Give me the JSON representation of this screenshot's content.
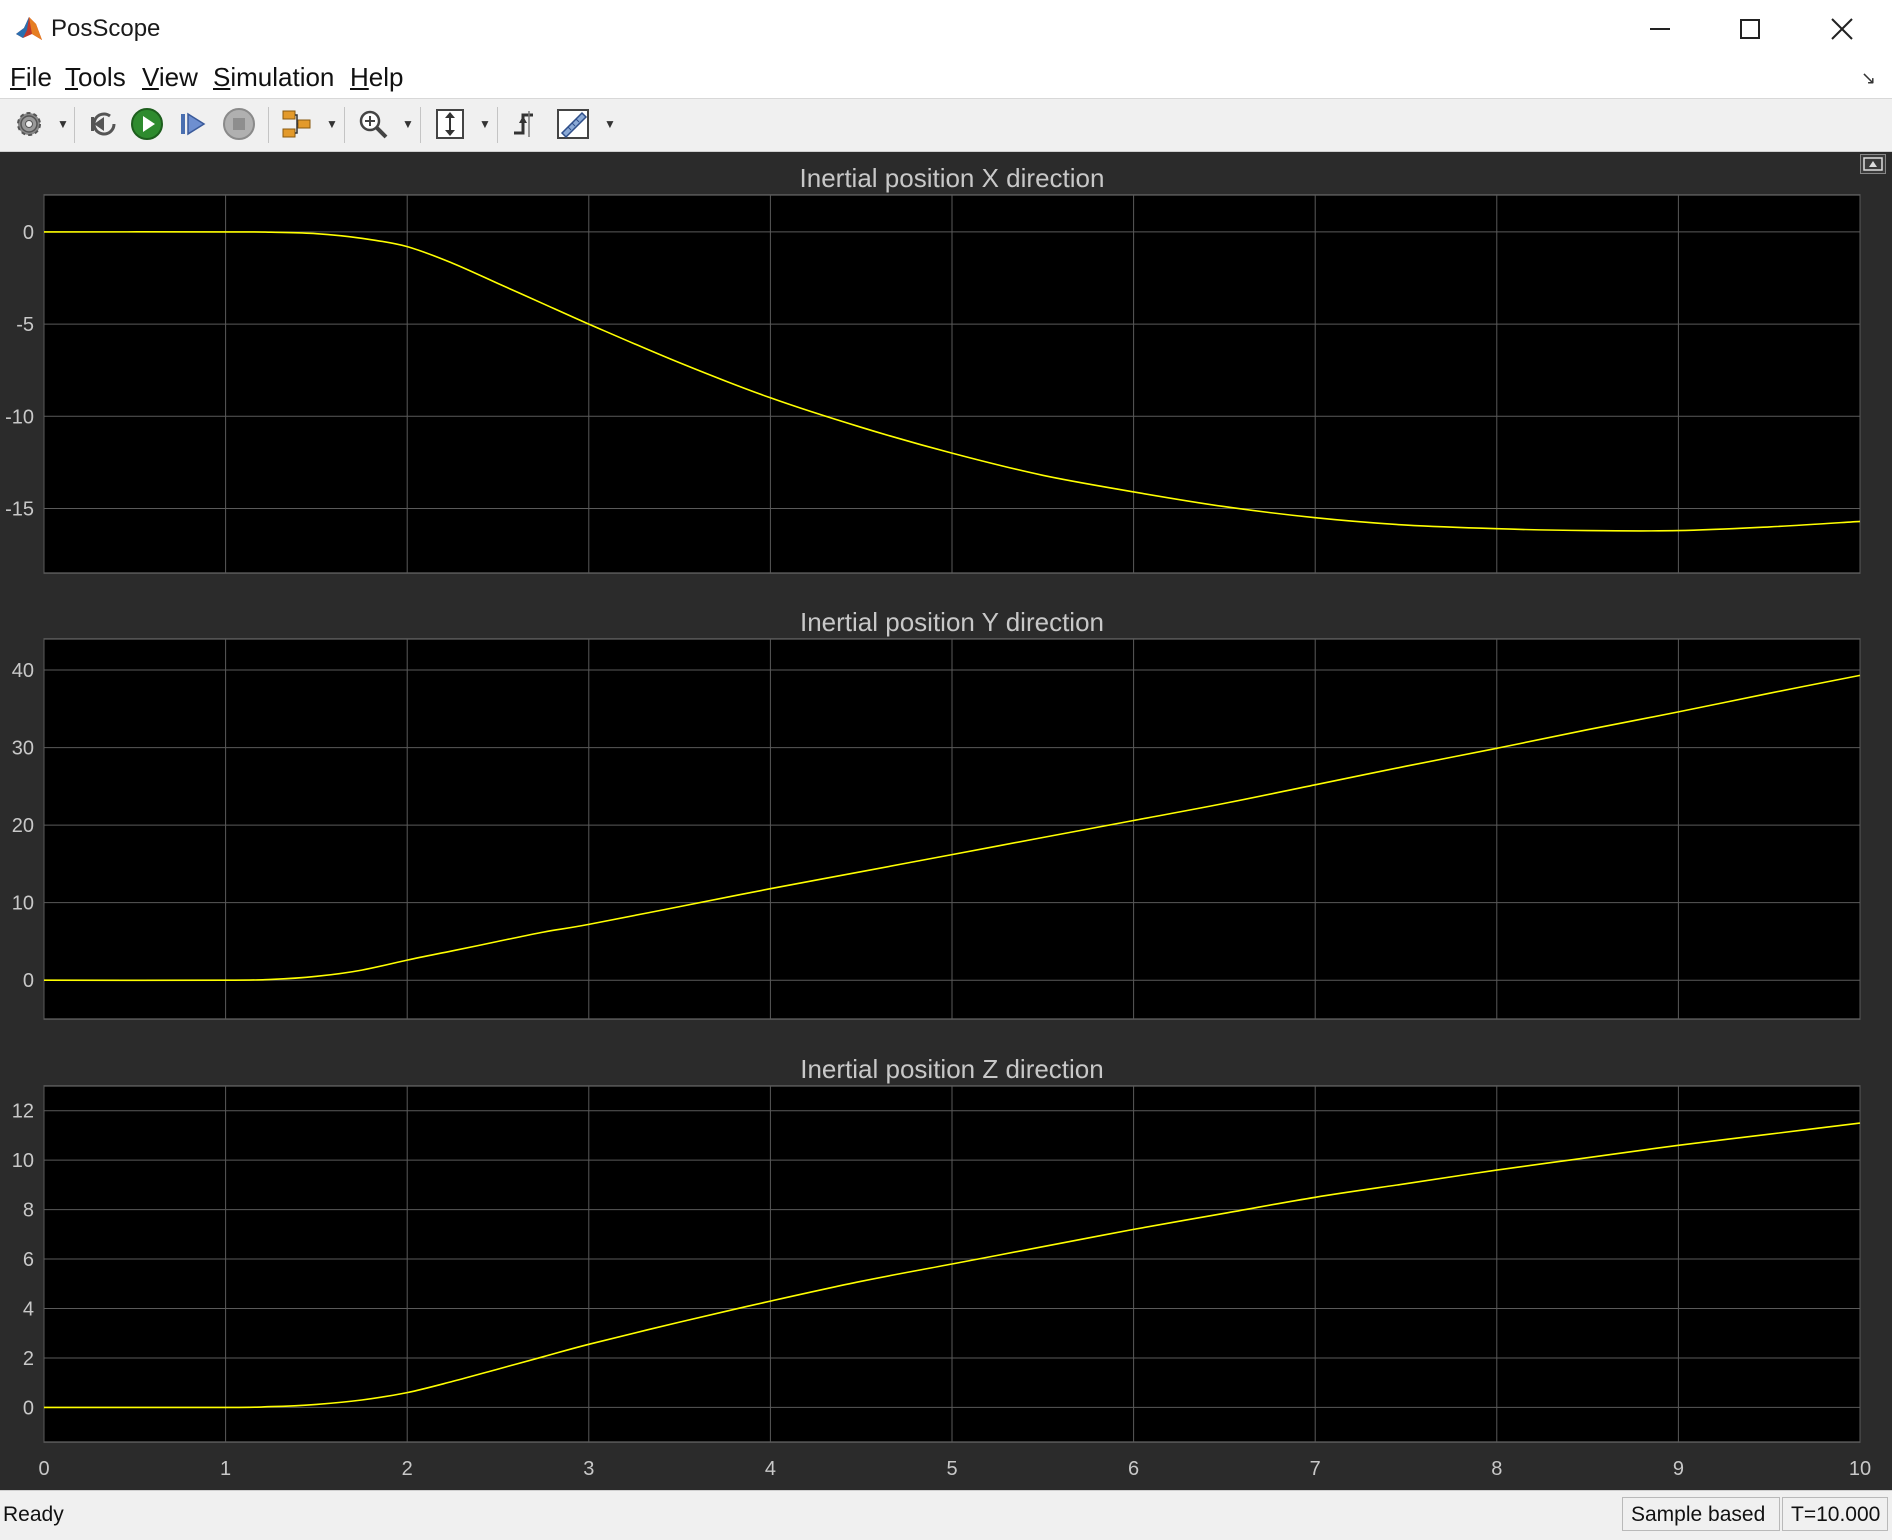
{
  "window": {
    "title": "PosScope"
  },
  "menu": [
    {
      "label": "File"
    },
    {
      "label": "Tools"
    },
    {
      "label": "View"
    },
    {
      "label": "Simulation"
    },
    {
      "label": "Help"
    }
  ],
  "toolbar": {
    "buttons": [
      {
        "name": "settings-button",
        "icon": "gear-icon"
      },
      {
        "name": "step-back-button",
        "icon": "step-back-icon"
      },
      {
        "name": "run-button",
        "icon": "play-icon"
      },
      {
        "name": "step-forward-button",
        "icon": "step-forward-icon"
      },
      {
        "name": "stop-button",
        "icon": "stop-icon"
      },
      {
        "name": "highlight-block-button",
        "icon": "block-diagram-icon"
      },
      {
        "name": "zoom-button",
        "icon": "zoom-in-icon"
      },
      {
        "name": "scale-axes-button",
        "icon": "fit-axes-icon"
      },
      {
        "name": "triggers-button",
        "icon": "trigger-icon"
      },
      {
        "name": "measurements-button",
        "icon": "ruler-icon"
      }
    ]
  },
  "status": {
    "text": "Ready",
    "mode": "Sample based",
    "time": "T=10.000"
  },
  "colors": {
    "trace": "#ffff00",
    "plot_bg": "#000000",
    "scope_bg": "#2b2b2b",
    "grid": "#5a5a5a",
    "text": "#c8c8c8"
  },
  "chart_data": [
    {
      "type": "line",
      "title": "Inertial position X direction",
      "xlim": [
        0,
        10
      ],
      "ylim": [
        -18.5,
        2
      ],
      "yticks": [
        0,
        -5,
        -10,
        -15
      ],
      "xticks": [
        0,
        1,
        2,
        3,
        4,
        5,
        6,
        7,
        8,
        9,
        10
      ],
      "show_xtick_labels": false,
      "grid": true,
      "x": [
        0,
        1,
        1.25,
        1.5,
        1.75,
        2,
        2.25,
        2.5,
        2.75,
        3,
        3.5,
        4,
        4.5,
        5,
        5.5,
        6,
        6.5,
        7,
        7.5,
        8,
        8.5,
        9,
        9.5,
        10
      ],
      "y": [
        0,
        0,
        -0.02,
        -0.1,
        -0.35,
        -0.8,
        -1.7,
        -2.8,
        -3.9,
        -5.0,
        -7.1,
        -9.0,
        -10.6,
        -12.0,
        -13.2,
        -14.1,
        -14.9,
        -15.5,
        -15.9,
        -16.1,
        -16.2,
        -16.2,
        -16.0,
        -15.7
      ]
    },
    {
      "type": "line",
      "title": "Inertial position Y direction",
      "xlim": [
        0,
        10
      ],
      "ylim": [
        -5,
        44
      ],
      "yticks": [
        0,
        10,
        20,
        30,
        40
      ],
      "xticks": [
        0,
        1,
        2,
        3,
        4,
        5,
        6,
        7,
        8,
        9,
        10
      ],
      "show_xtick_labels": false,
      "grid": true,
      "x": [
        0,
        1,
        1.25,
        1.5,
        1.75,
        2,
        2.25,
        2.5,
        2.75,
        3,
        3.5,
        4,
        4.5,
        5,
        5.5,
        6,
        6.5,
        7,
        7.5,
        8,
        8.5,
        9,
        9.5,
        10
      ],
      "y": [
        0,
        0,
        0.1,
        0.5,
        1.3,
        2.6,
        3.8,
        5.0,
        6.2,
        7.2,
        9.5,
        11.8,
        14.0,
        16.2,
        18.4,
        20.6,
        22.8,
        25.2,
        27.6,
        29.9,
        32.3,
        34.6,
        37.0,
        39.3
      ]
    },
    {
      "type": "line",
      "title": "Inertial position Z direction",
      "xlim": [
        0,
        10
      ],
      "ylim": [
        -1.4,
        13
      ],
      "yticks": [
        0,
        2,
        4,
        6,
        8,
        10,
        12
      ],
      "xticks": [
        0,
        1,
        2,
        3,
        4,
        5,
        6,
        7,
        8,
        9,
        10
      ],
      "show_xtick_labels": true,
      "grid": true,
      "x": [
        0,
        1,
        1.25,
        1.5,
        1.75,
        2,
        2.25,
        2.5,
        2.75,
        3,
        3.5,
        4,
        4.5,
        5,
        5.5,
        6,
        6.5,
        7,
        7.5,
        8,
        8.5,
        9,
        9.5,
        10
      ],
      "y": [
        0,
        0,
        0.03,
        0.12,
        0.3,
        0.6,
        1.05,
        1.55,
        2.05,
        2.55,
        3.45,
        4.3,
        5.1,
        5.8,
        6.5,
        7.2,
        7.85,
        8.5,
        9.05,
        9.6,
        10.1,
        10.6,
        11.05,
        11.5
      ]
    }
  ]
}
